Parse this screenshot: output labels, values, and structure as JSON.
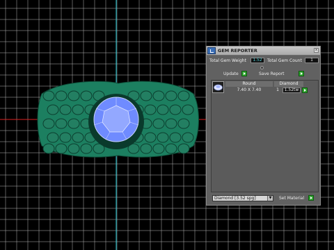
{
  "panel": {
    "title": "GEM REPORTER",
    "total_weight_label": "Total Gem Weight",
    "total_weight_value": "1.52",
    "total_count_label": "Total Gem Count",
    "total_count_value": "1",
    "update_label": "Update",
    "save_report_label": "Save Report",
    "columns": {
      "shape": "Round",
      "material": "Diamond"
    },
    "rows": [
      {
        "size": "7.40 X 7.40",
        "count": "1",
        "weight": "1.52tw"
      }
    ],
    "material_select": "Diamond  [3.52 spg]",
    "set_material_label": "Set Material",
    "close_glyph": "x"
  },
  "viewport": {
    "background": "#000000",
    "grid_color": "#b9b9b9",
    "axis_color": "#1ec6d2",
    "ring_color": "#1c7f60",
    "gem_color": "#6f8bff"
  }
}
